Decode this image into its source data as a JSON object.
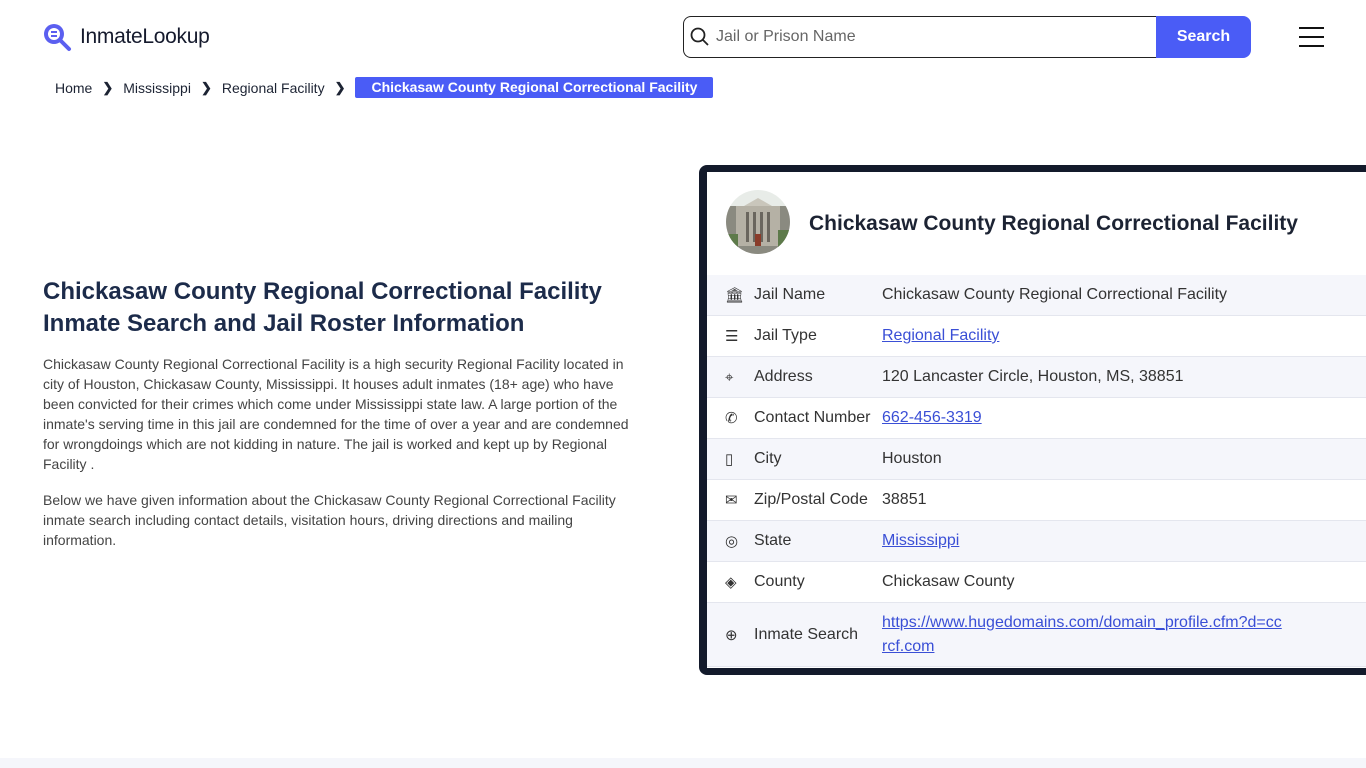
{
  "header": {
    "logo": "InmateLookup",
    "search_placeholder": "Jail or Prison Name",
    "search_button": "Search"
  },
  "breadcrumb": [
    "Home",
    "Mississippi",
    "Regional Facility",
    "Chickasaw County Regional Correctional Facility"
  ],
  "main": {
    "title": "Chickasaw County Regional Correctional Facility Inmate Search and Jail Roster Information",
    "p1": "Chickasaw County Regional Correctional Facility is a high security Regional Facility located in city of Houston, Chickasaw County, Mississippi. It houses adult inmates (18+ age) who have been convicted for their crimes which come under Mississippi state law. A large portion of the inmate's serving time in this jail are condemned for the time of over a year and are condemned for wrongdoings which are not kidding in nature. The jail is worked and kept up by Regional Facility .",
    "p2": "Below we have given information about the Chickasaw County Regional Correctional Facility inmate search including contact details, visitation hours, driving directions and mailing information."
  },
  "card": {
    "title": "Chickasaw County Regional Correctional Facility",
    "rows": [
      {
        "icon": "bank-icon",
        "label": "Jail Name",
        "value": "Chickasaw County Regional Correctional Facility",
        "link": false
      },
      {
        "icon": "list-icon",
        "label": "Jail Type",
        "value": "Regional Facility",
        "link": true
      },
      {
        "icon": "map-pin-icon",
        "label": "Address",
        "value": "120 Lancaster Circle, Houston, MS, 38851",
        "link": false
      },
      {
        "icon": "phone-icon",
        "label": "Contact Number",
        "value": "662-456-3319",
        "link": true
      },
      {
        "icon": "map-icon",
        "label": "City",
        "value": "Houston",
        "link": false
      },
      {
        "icon": "mail-icon",
        "label": "Zip/Postal Code",
        "value": "38851",
        "link": false
      },
      {
        "icon": "globe-icon",
        "label": "State",
        "value": "Mississippi",
        "link": true
      },
      {
        "icon": "county-icon",
        "label": "County",
        "value": "Chickasaw County",
        "link": false
      },
      {
        "icon": "world-icon",
        "label": "Inmate Search",
        "value": "https://www.hugedomains.com/domain_profile.cfm?d=ccrcf.com",
        "link": true
      }
    ]
  },
  "colors": {
    "accent": "#4a5cf6",
    "card_border": "#131a2b"
  }
}
